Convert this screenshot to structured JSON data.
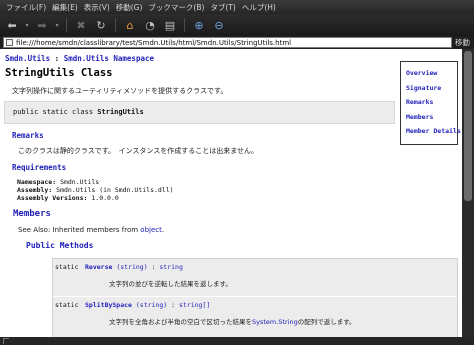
{
  "menu": [
    "ファイル(F)",
    "編集(E)",
    "表示(V)",
    "移動(G)",
    "ブックマーク(B)",
    "タブ(T)",
    "ヘルプ(H)"
  ],
  "location": {
    "url": "file:///home/smdn/classlibrary/test/Smdn.Utils/html/Smdn.Utils/StringUtils.html",
    "go_label": "移動"
  },
  "breadcrumb": {
    "assembly": "Smdn.Utils",
    "sep": ":",
    "namespace": "Smdn.Utils Namespace"
  },
  "page": {
    "title": "StringUtils Class",
    "description": "文字列操作に関するユーティリティメソッドを提供するクラスです。",
    "signature_prefix": "public static class ",
    "signature_name": "StringUtils"
  },
  "nav": [
    "Overview",
    "Signature",
    "Remarks",
    "Members",
    "Member Details"
  ],
  "remarks": {
    "heading": "Remarks",
    "text": "このクラスは静的クラスです。　インスタンスを作成することは出来ません。"
  },
  "requirements": {
    "heading": "Requirements",
    "namespace_label": "Namespace:",
    "namespace_value": "Smdn.Utils",
    "assembly_label": "Assembly:",
    "assembly_value": "Smdn.Utils (in Smdn.Utils.dll)",
    "version_label": "Assembly Versions:",
    "version_value": "1.0.0.0"
  },
  "members": {
    "heading": "Members",
    "see_also_prefix": "See Also: Inherited members from ",
    "see_also_link": "object",
    "see_also_suffix": ".",
    "public_methods_heading": "Public Methods",
    "methods": [
      {
        "modifier": "static",
        "name": "Reverse",
        "params": " (string)",
        "colon": " : ",
        "ret": "string",
        "desc": "文字列の並びを逆転した結果を返します。"
      },
      {
        "modifier": "static",
        "name": "SplitBySpace",
        "params": " (string)",
        "colon": " : ",
        "ret": "string[]",
        "desc_prefix": "文字列を全角および半角の空白で区切った結果を",
        "desc_link": "System.String",
        "desc_suffix": "の配列で返します。"
      }
    ]
  }
}
